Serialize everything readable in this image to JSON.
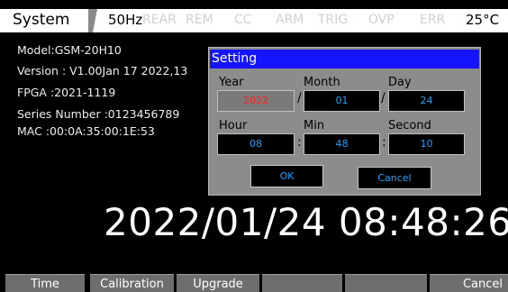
{
  "status_bar": {
    "title": "System",
    "frequency": "50Hz",
    "annunciators": [
      "REAR",
      "REM",
      "CC",
      "ARM",
      "TRIG",
      "OVP",
      "ERR"
    ],
    "temperature": "25°C"
  },
  "info": {
    "model": "Model:GSM-20H10",
    "version": "Version : V1.00Jan 17 2022,13",
    "fpga": "FPGA :2021-1119",
    "series": "Series Number :0123456789",
    "mac": "MAC :00:0A:35:00:1E:53"
  },
  "clock": "2022/01/24 08:48:26",
  "dialog": {
    "title": "Setting",
    "year_label": "Year",
    "month_label": "Month",
    "day_label": "Day",
    "hour_label": "Hour",
    "min_label": "Min",
    "second_label": "Second",
    "year": "2022",
    "month": "01",
    "day": "24",
    "hour": "08",
    "min": "48",
    "second": "10",
    "date_sep": "/",
    "time_sep": ":",
    "ok": "OK",
    "cancel": "Cancel"
  },
  "softkeys": [
    "Time",
    "Calibration",
    "Upgrade",
    "",
    "",
    "Cancel"
  ],
  "colors": {
    "dialog_title": "#1414ff",
    "field_text": "#1fa0ff",
    "year_text": "#ff2020"
  }
}
